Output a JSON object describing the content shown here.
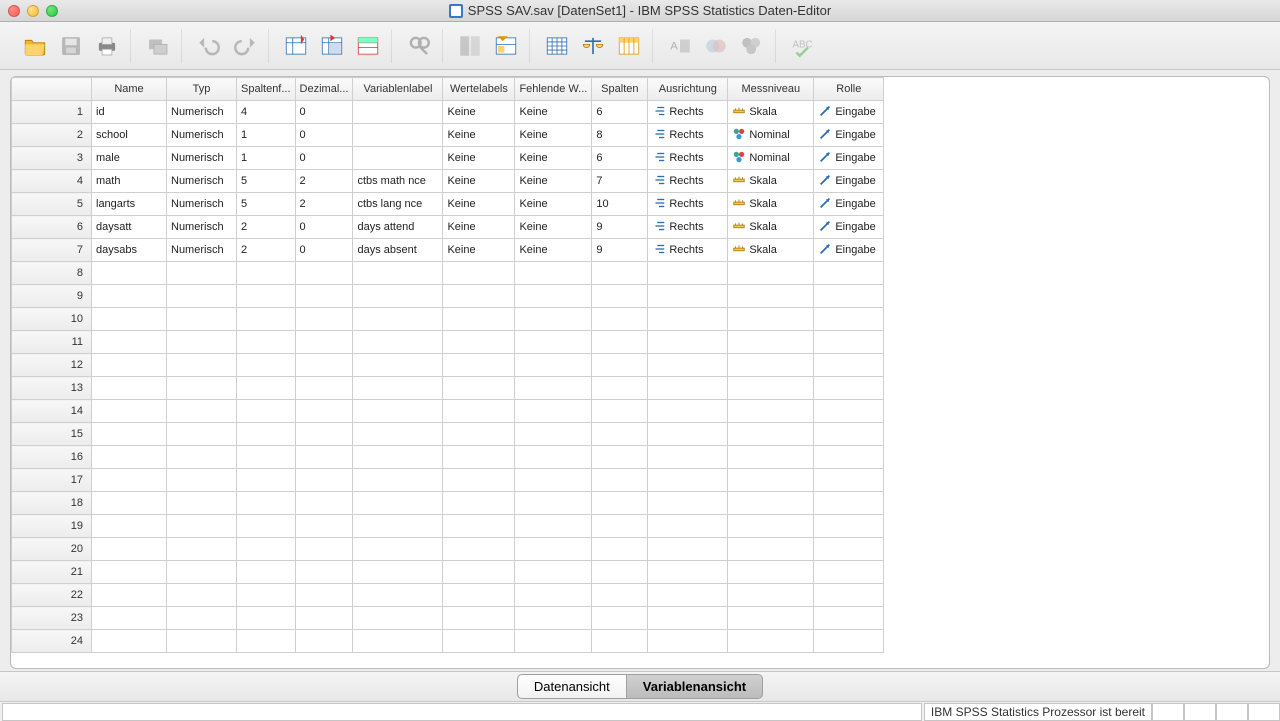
{
  "window": {
    "title": "SPSS SAV.sav [DatenSet1] - IBM SPSS Statistics Daten-Editor"
  },
  "columns": {
    "name": "Name",
    "typ": "Typ",
    "spaltenf": "Spaltenf...",
    "dezimal": "Dezimal...",
    "variablenlabel": "Variablenlabel",
    "wertelabels": "Wertelabels",
    "fehlende": "Fehlende W...",
    "spalten": "Spalten",
    "ausrichtung": "Ausrichtung",
    "messniveau": "Messniveau",
    "rolle": "Rolle"
  },
  "rows": [
    {
      "name": "id",
      "typ": "Numerisch",
      "spaltenf": "4",
      "dezimal": "0",
      "variablenlabel": "",
      "wertelabels": "Keine",
      "fehlende": "Keine",
      "spalten": "6",
      "ausrichtung": "Rechts",
      "messniveau": "Skala",
      "rolle": "Eingabe",
      "measure": "scale"
    },
    {
      "name": "school",
      "typ": "Numerisch",
      "spaltenf": "1",
      "dezimal": "0",
      "variablenlabel": "",
      "wertelabels": "Keine",
      "fehlende": "Keine",
      "spalten": "8",
      "ausrichtung": "Rechts",
      "messniveau": "Nominal",
      "rolle": "Eingabe",
      "measure": "nominal"
    },
    {
      "name": "male",
      "typ": "Numerisch",
      "spaltenf": "1",
      "dezimal": "0",
      "variablenlabel": "",
      "wertelabels": "Keine",
      "fehlende": "Keine",
      "spalten": "6",
      "ausrichtung": "Rechts",
      "messniveau": "Nominal",
      "rolle": "Eingabe",
      "measure": "nominal"
    },
    {
      "name": "math",
      "typ": "Numerisch",
      "spaltenf": "5",
      "dezimal": "2",
      "variablenlabel": "ctbs math nce",
      "wertelabels": "Keine",
      "fehlende": "Keine",
      "spalten": "7",
      "ausrichtung": "Rechts",
      "messniveau": "Skala",
      "rolle": "Eingabe",
      "measure": "scale"
    },
    {
      "name": "langarts",
      "typ": "Numerisch",
      "spaltenf": "5",
      "dezimal": "2",
      "variablenlabel": "ctbs lang nce",
      "wertelabels": "Keine",
      "fehlende": "Keine",
      "spalten": "10",
      "ausrichtung": "Rechts",
      "messniveau": "Skala",
      "rolle": "Eingabe",
      "measure": "scale"
    },
    {
      "name": "daysatt",
      "typ": "Numerisch",
      "spaltenf": "2",
      "dezimal": "0",
      "variablenlabel": "days attend",
      "wertelabels": "Keine",
      "fehlende": "Keine",
      "spalten": "9",
      "ausrichtung": "Rechts",
      "messniveau": "Skala",
      "rolle": "Eingabe",
      "measure": "scale"
    },
    {
      "name": "daysabs",
      "typ": "Numerisch",
      "spaltenf": "2",
      "dezimal": "0",
      "variablenlabel": "days absent",
      "wertelabels": "Keine",
      "fehlende": "Keine",
      "spalten": "9",
      "ausrichtung": "Rechts",
      "messniveau": "Skala",
      "rolle": "Eingabe",
      "measure": "scale"
    }
  ],
  "tabs": {
    "data": "Datenansicht",
    "variable": "Variablenansicht"
  },
  "status": {
    "message": "IBM SPSS Statistics  Prozessor ist bereit"
  },
  "totalRows": 24
}
